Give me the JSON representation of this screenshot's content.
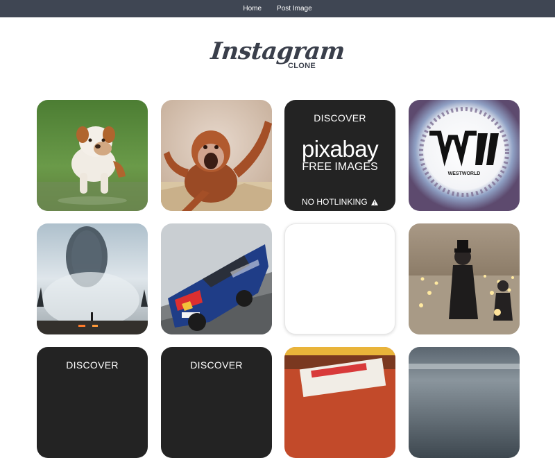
{
  "nav": {
    "home_label": "Home",
    "post_label": "Post Image"
  },
  "logo": {
    "title": "Instagram",
    "subtitle": "CLONE"
  },
  "pixabay_tile": {
    "discover": "DISCOVER",
    "brand": "pixabay",
    "free_images": "FREE IMAGES",
    "no_hotlinking": "NO HOTLINKING",
    "warning_icon": "warning-icon"
  },
  "westworld": {
    "title": "WESTWORLD"
  },
  "row3": {
    "discover_a": "DISCOVER",
    "discover_b": "DISCOVER"
  },
  "colors": {
    "navbar": "#3f4653",
    "logo": "#3a3f4b",
    "placeholder_tile": "#232323"
  }
}
